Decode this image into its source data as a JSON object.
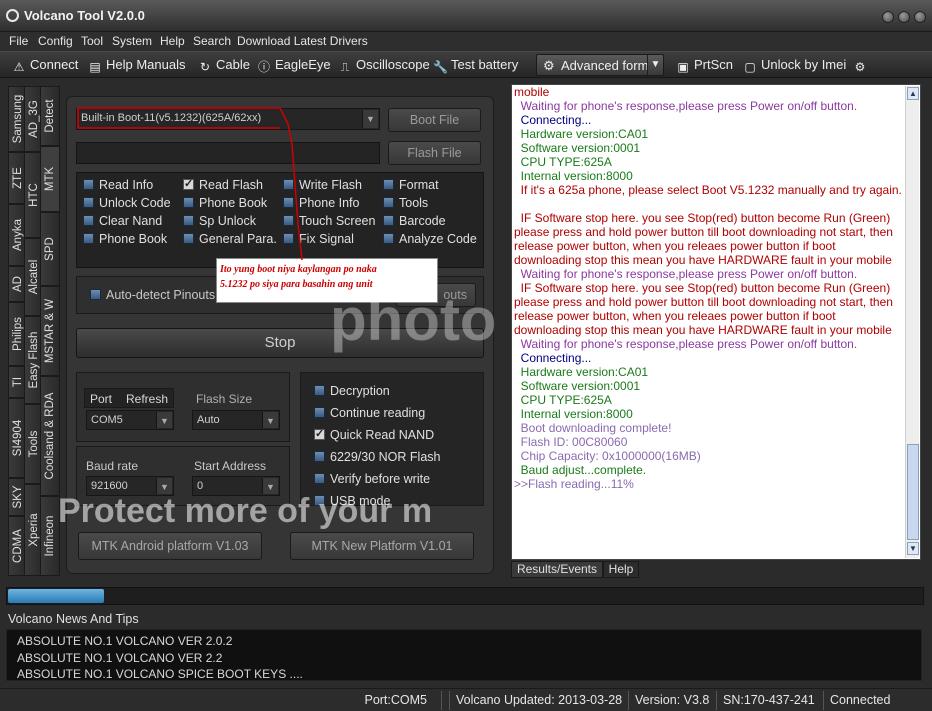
{
  "window": {
    "title": "Volcano Tool V2.0.0"
  },
  "menu": [
    "File",
    "Config",
    "Tool",
    "System",
    "Help",
    "Search",
    "Download Latest Drivers"
  ],
  "toolbar": {
    "connect": "Connect",
    "help_manuals": "Help Manuals",
    "cable": "Cable",
    "eagleeye": "EagleEye",
    "oscilloscope": "Oscilloscope",
    "test_battery": "Test battery",
    "advanced_form": "Advanced form",
    "prtscn": "PrtScn",
    "unlock_imei": "Unlock by Imei"
  },
  "brand_tabs": [
    "Samsung",
    "ZTE",
    "Anyka",
    "AD",
    "Philips",
    "TI",
    "SI4904",
    "SKY",
    "CDMA"
  ],
  "brand_tabs_2": [
    "AD_3G",
    "HTC",
    "Alcatel",
    "Easy Flash",
    "Tools",
    "Xperia"
  ],
  "chip_tabs": [
    "Detect",
    "MTK",
    "SPD",
    "MSTAR & W",
    "Coolsand & RDA",
    "Infineon"
  ],
  "mtk": {
    "boot_combo": "Built-in Boot-11(v5.1232)(625A/62xx)",
    "boot_file_btn": "Boot File",
    "flash_file_btn": "Flash File",
    "options": [
      {
        "label": "Read Info",
        "checked": false
      },
      {
        "label": "Read Flash",
        "checked": true
      },
      {
        "label": "Write Flash",
        "checked": false
      },
      {
        "label": "Format",
        "checked": false
      },
      {
        "label": "Unlock Code",
        "checked": false
      },
      {
        "label": "Phone Book",
        "checked": false
      },
      {
        "label": "Phone Info",
        "checked": false
      },
      {
        "label": "Tools",
        "checked": false
      },
      {
        "label": "Clear Nand",
        "checked": false
      },
      {
        "label": "Sp Unlock",
        "checked": false
      },
      {
        "label": "Touch Screen",
        "checked": false
      },
      {
        "label": "Barcode",
        "checked": false
      },
      {
        "label": "Phone Book",
        "checked": false
      },
      {
        "label": "General Para.",
        "checked": false
      },
      {
        "label": "Fix Signal",
        "checked": false
      },
      {
        "label": "Analyze Code",
        "checked": false
      }
    ],
    "autodetect": "Auto-detect Pinouts",
    "pinouts_btn": "outs",
    "stop_btn": "Stop",
    "port_label": "Port",
    "refresh_label": "Refresh",
    "port_value": "COM5",
    "flash_size_label": "Flash Size",
    "flash_size_value": "Auto",
    "baud_label": "Baud rate",
    "baud_value": "921600",
    "start_addr_label": "Start Address",
    "start_addr_value": "0",
    "right_options": [
      {
        "label": "Decryption",
        "checked": false
      },
      {
        "label": "Continue reading",
        "checked": false
      },
      {
        "label": "Quick Read NAND",
        "checked": true
      },
      {
        "label": "6229/30 NOR Flash",
        "checked": false
      },
      {
        "label": "Verify before write",
        "checked": false
      },
      {
        "label": "USB mode",
        "checked": false
      }
    ],
    "android_btn": "MTK Android platform V1.03",
    "new_platform_btn": "MTK New Platform V1.01"
  },
  "annotation": {
    "line1": "Ito yung boot niya kaylangan po naka",
    "line2": "5.1232 po siya para basahin ang unit"
  },
  "log": [
    {
      "t": "mobile",
      "c": "red"
    },
    {
      "t": "  Waiting for phone's response,please press Power on/off button.",
      "c": "purple"
    },
    {
      "t": "  Connecting...",
      "c": "navy"
    },
    {
      "t": "  Hardware version:CA01",
      "c": "green"
    },
    {
      "t": "  Software version:0001",
      "c": "green"
    },
    {
      "t": "  CPU TYPE:625A",
      "c": "green"
    },
    {
      "t": "  Internal version:8000",
      "c": "green"
    },
    {
      "t": "  If it's a 625a phone, please select Boot V5.1232 manually and try again.",
      "c": "red"
    },
    {
      "t": " ",
      "c": "red"
    },
    {
      "t": "  IF Software stop here. you see Stop(red) button become Run (Green) please press and hold power button till boot downloading not start, then release power button, when you releaes power button if boot downloading stop this mean you have HARDWARE fault in your mobile",
      "c": "red"
    },
    {
      "t": "  Waiting for phone's response,please press Power on/off button.",
      "c": "purple"
    },
    {
      "t": "  IF Software stop here. you see Stop(red) button become Run (Green) please press and hold power button till boot downloading not start, then release power button, when you releaes power button if boot downloading stop this mean you have HARDWARE fault in your mobile",
      "c": "red"
    },
    {
      "t": "  Waiting for phone's response,please press Power on/off button.",
      "c": "purple"
    },
    {
      "t": "  Connecting...",
      "c": "navy"
    },
    {
      "t": "  Hardware version:CA01",
      "c": "green"
    },
    {
      "t": "  Software version:0001",
      "c": "green"
    },
    {
      "t": "  CPU TYPE:625A",
      "c": "green"
    },
    {
      "t": "  Internal version:8000",
      "c": "green"
    },
    {
      "t": "  Boot downloading complete!",
      "c": "pale"
    },
    {
      "t": "  Flash ID: 00C80060",
      "c": "pale"
    },
    {
      "t": "  Chip Capacity: 0x1000000(16MB)",
      "c": "pale"
    },
    {
      "t": "  Baud adjust...complete.",
      "c": "green"
    },
    {
      "t": ">>Flash reading...11%",
      "c": "pale"
    }
  ],
  "log_tabs": {
    "results": "Results/Events",
    "help": "Help"
  },
  "progress": {
    "fraction": 0.105
  },
  "news": {
    "title": "Volcano News And Tips",
    "items": [
      "ABSOLUTE NO.1 VOLCANO VER 2.0.2",
      "ABSOLUTE NO.1 VOLCANO VER 2.2",
      "ABSOLUTE NO.1 VOLCANO SPICE BOOT KEYS ...."
    ]
  },
  "status": {
    "port": "Port:COM5",
    "updated": "Volcano Updated: 2013-03-28",
    "version": "Version: V3.8",
    "sn": "SN:170-437-241",
    "state": "Connected"
  },
  "watermark": {
    "text": "Protect more of your m",
    "logo": "photo"
  }
}
